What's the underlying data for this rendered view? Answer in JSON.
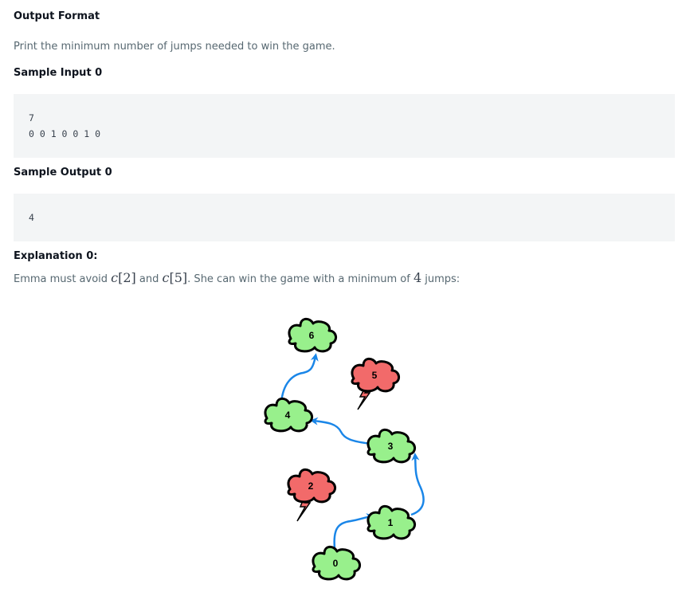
{
  "sections": {
    "output_format": {
      "heading": "Output Format",
      "text": "Print the minimum number of jumps needed to win the game."
    },
    "sample_input": {
      "heading": "Sample Input 0",
      "lines": [
        "7",
        "0 0 1 0 0 1 0"
      ]
    },
    "sample_output": {
      "heading": "Sample Output 0",
      "lines": [
        "4"
      ]
    },
    "explanation": {
      "heading": "Explanation 0:",
      "prefix": "Emma must avoid ",
      "var1": "c",
      "idx1": "[2]",
      "mid": " and ",
      "var2": "c",
      "idx2": "[5]",
      "mid2": ". She can win the game with a minimum of ",
      "count": "4",
      "suffix": " jumps:"
    }
  },
  "diagram": {
    "colors": {
      "safe": "#98f08c",
      "thunder": "#f26a6a",
      "arrow": "#1a86e8",
      "outline": "#000000"
    },
    "clouds": [
      {
        "label": "0",
        "kind": "safe"
      },
      {
        "label": "1",
        "kind": "safe"
      },
      {
        "label": "2",
        "kind": "thunder"
      },
      {
        "label": "3",
        "kind": "safe"
      },
      {
        "label": "4",
        "kind": "safe"
      },
      {
        "label": "5",
        "kind": "thunder"
      },
      {
        "label": "6",
        "kind": "safe"
      }
    ],
    "jumps": [
      {
        "from": "0",
        "to": "1"
      },
      {
        "from": "1",
        "to": "3"
      },
      {
        "from": "3",
        "to": "4"
      },
      {
        "from": "4",
        "to": "6"
      }
    ]
  }
}
